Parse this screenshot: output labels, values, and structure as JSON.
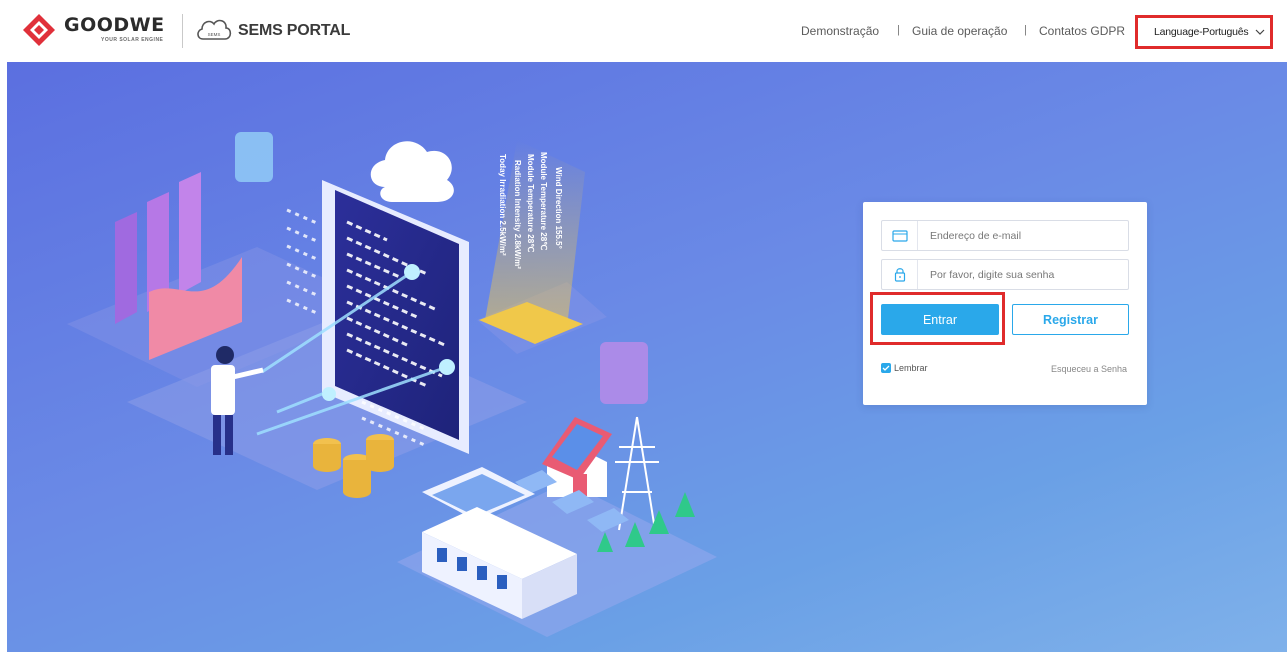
{
  "header": {
    "brand": {
      "name": "GOODWE",
      "tagline": "YOUR SOLAR ENGINE"
    },
    "portal": {
      "cloud_badge": "SEMS",
      "name": "SEMS PORTAL"
    },
    "nav": {
      "demo": "Demonstração",
      "guide": "Guia de operação",
      "gdpr": "Contatos GDPR",
      "separator": "|"
    },
    "language": {
      "label": "Language-Português",
      "icon": "chevron-down-icon"
    }
  },
  "hero": {
    "weather_lines": [
      "Wind Direction 155.5°",
      "Module Temperature 28℃",
      "Module Temperature 28℃",
      "Radiation Intensity 2.8kW/m²",
      "Today Irradiation 2.5kW/m²"
    ]
  },
  "login": {
    "email": {
      "placeholder": "Endereço de e-mail",
      "value": "",
      "icon": "card-icon"
    },
    "password": {
      "placeholder": "Por favor, digite sua senha",
      "value": "",
      "icon": "lock-icon"
    },
    "login_button": "Entrar",
    "register_button": "Registrar",
    "remember": {
      "label": "Lembrar",
      "checked": true
    },
    "forgot_password": "Esqueceu a Senha"
  },
  "colors": {
    "accent": "#2aa8ea",
    "highlight": "#e02b2b",
    "hero_start": "#5b6fe0",
    "hero_end": "#7fb1ea",
    "logo_red": "#e0303a"
  }
}
